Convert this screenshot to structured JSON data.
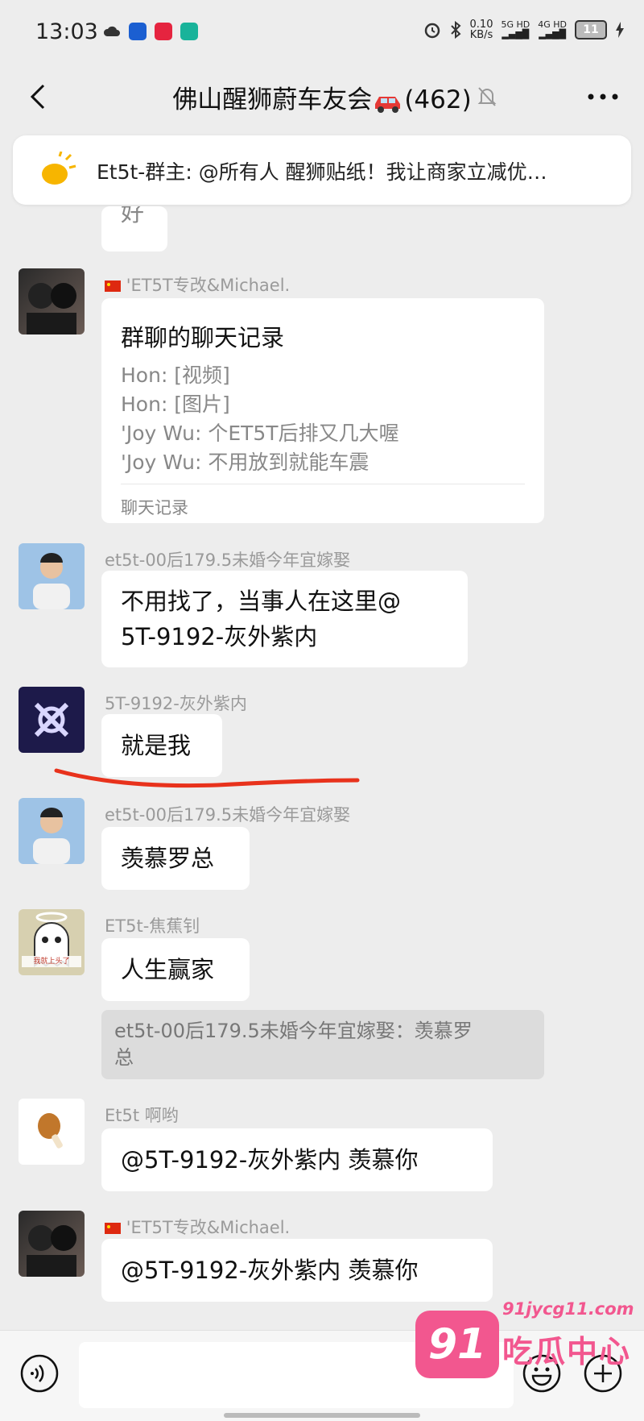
{
  "status_bar": {
    "time": "13:03",
    "speed_value": "0.10",
    "speed_unit": "KB/s",
    "signal1": "5G HD",
    "signal2": "4G HD",
    "battery": "11"
  },
  "header": {
    "title": "佛山醒狮蔚车友会",
    "member_count": "(462)",
    "icons": [
      "back-arrow-icon",
      "car-emoji-icon",
      "mute-bell-icon",
      "more-dots-icon"
    ]
  },
  "notice": {
    "text": "Et5t-群主: @所有人 醒狮贴纸！我让商家立减优…"
  },
  "partial_bubble_text": "好",
  "messages": {
    "m1": {
      "sender": "'ET5T专改&Michael.",
      "record": {
        "title": "群聊的聊天记录",
        "lines": [
          "Hon: [视频]",
          "Hon: [图片]",
          "'Joy Wu: 个ET5T后排又几大喔",
          "'Joy Wu: 不用放到就能车震"
        ],
        "footer": "聊天记录"
      }
    },
    "m2": {
      "sender": "et5t-00后179.5未婚今年宜嫁娶",
      "line1": "不用找了，当事人在这里@",
      "line2": "5T-9192-灰外紫内"
    },
    "m3": {
      "sender": "5T-9192-灰外紫内",
      "text": "就是我"
    },
    "m4": {
      "sender": "et5t-00后179.5未婚今年宜嫁娶",
      "text": "羡慕罗总"
    },
    "m5": {
      "sender": "ET5t-焦蕉钊",
      "text": "人生赢家",
      "avatar_caption": "我就上头了",
      "quote_line1": "et5t-00后179.5未婚今年宜嫁娶：羡慕罗",
      "quote_line2": "总"
    },
    "m6": {
      "sender": "Et5t 啊哟",
      "text": "@5T-9192-灰外紫内  羡慕你"
    },
    "m7": {
      "sender": "'ET5T专改&Michael.",
      "text": "@5T-9192-灰外紫内  羡慕你"
    }
  },
  "watermark": {
    "badge": "91",
    "url": "91jycg11.com",
    "name": "吃瓜中心"
  },
  "colors": {
    "background": "#ededed",
    "bubble": "#ffffff",
    "sender": "#9a9a9a",
    "annotation_red": "#e8321c",
    "watermark_pink": "#f2578f"
  }
}
